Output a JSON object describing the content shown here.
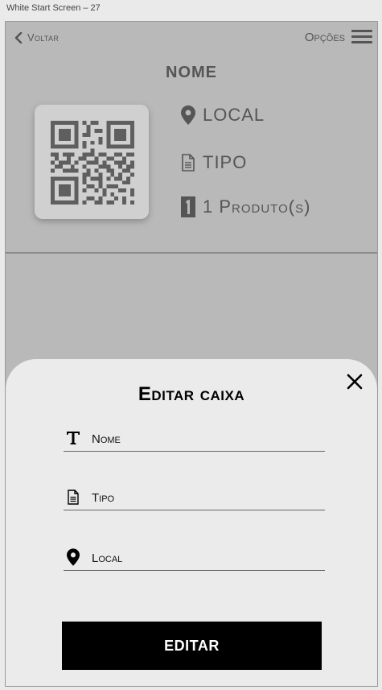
{
  "window": {
    "title": "White Start Screen – 27"
  },
  "topbar": {
    "back_label": "Voltar",
    "options_label": "Opções"
  },
  "item": {
    "name": "NOME",
    "local": "LOCAL",
    "tipo": "TIPO",
    "produtos": "1 Produto(s)"
  },
  "modal": {
    "title": "Editar caixa",
    "fields": {
      "nome": {
        "placeholder": "Nome"
      },
      "tipo": {
        "placeholder": "Tipo"
      },
      "local": {
        "placeholder": "Local"
      }
    },
    "submit_label": "EDITAR"
  },
  "icons": {
    "back": "chevron-left-icon",
    "menu": "hamburger-menu-icon",
    "location": "map-pin-icon",
    "document": "document-icon",
    "count": "number-one-icon",
    "text": "text-t-icon",
    "close": "close-x-icon"
  }
}
